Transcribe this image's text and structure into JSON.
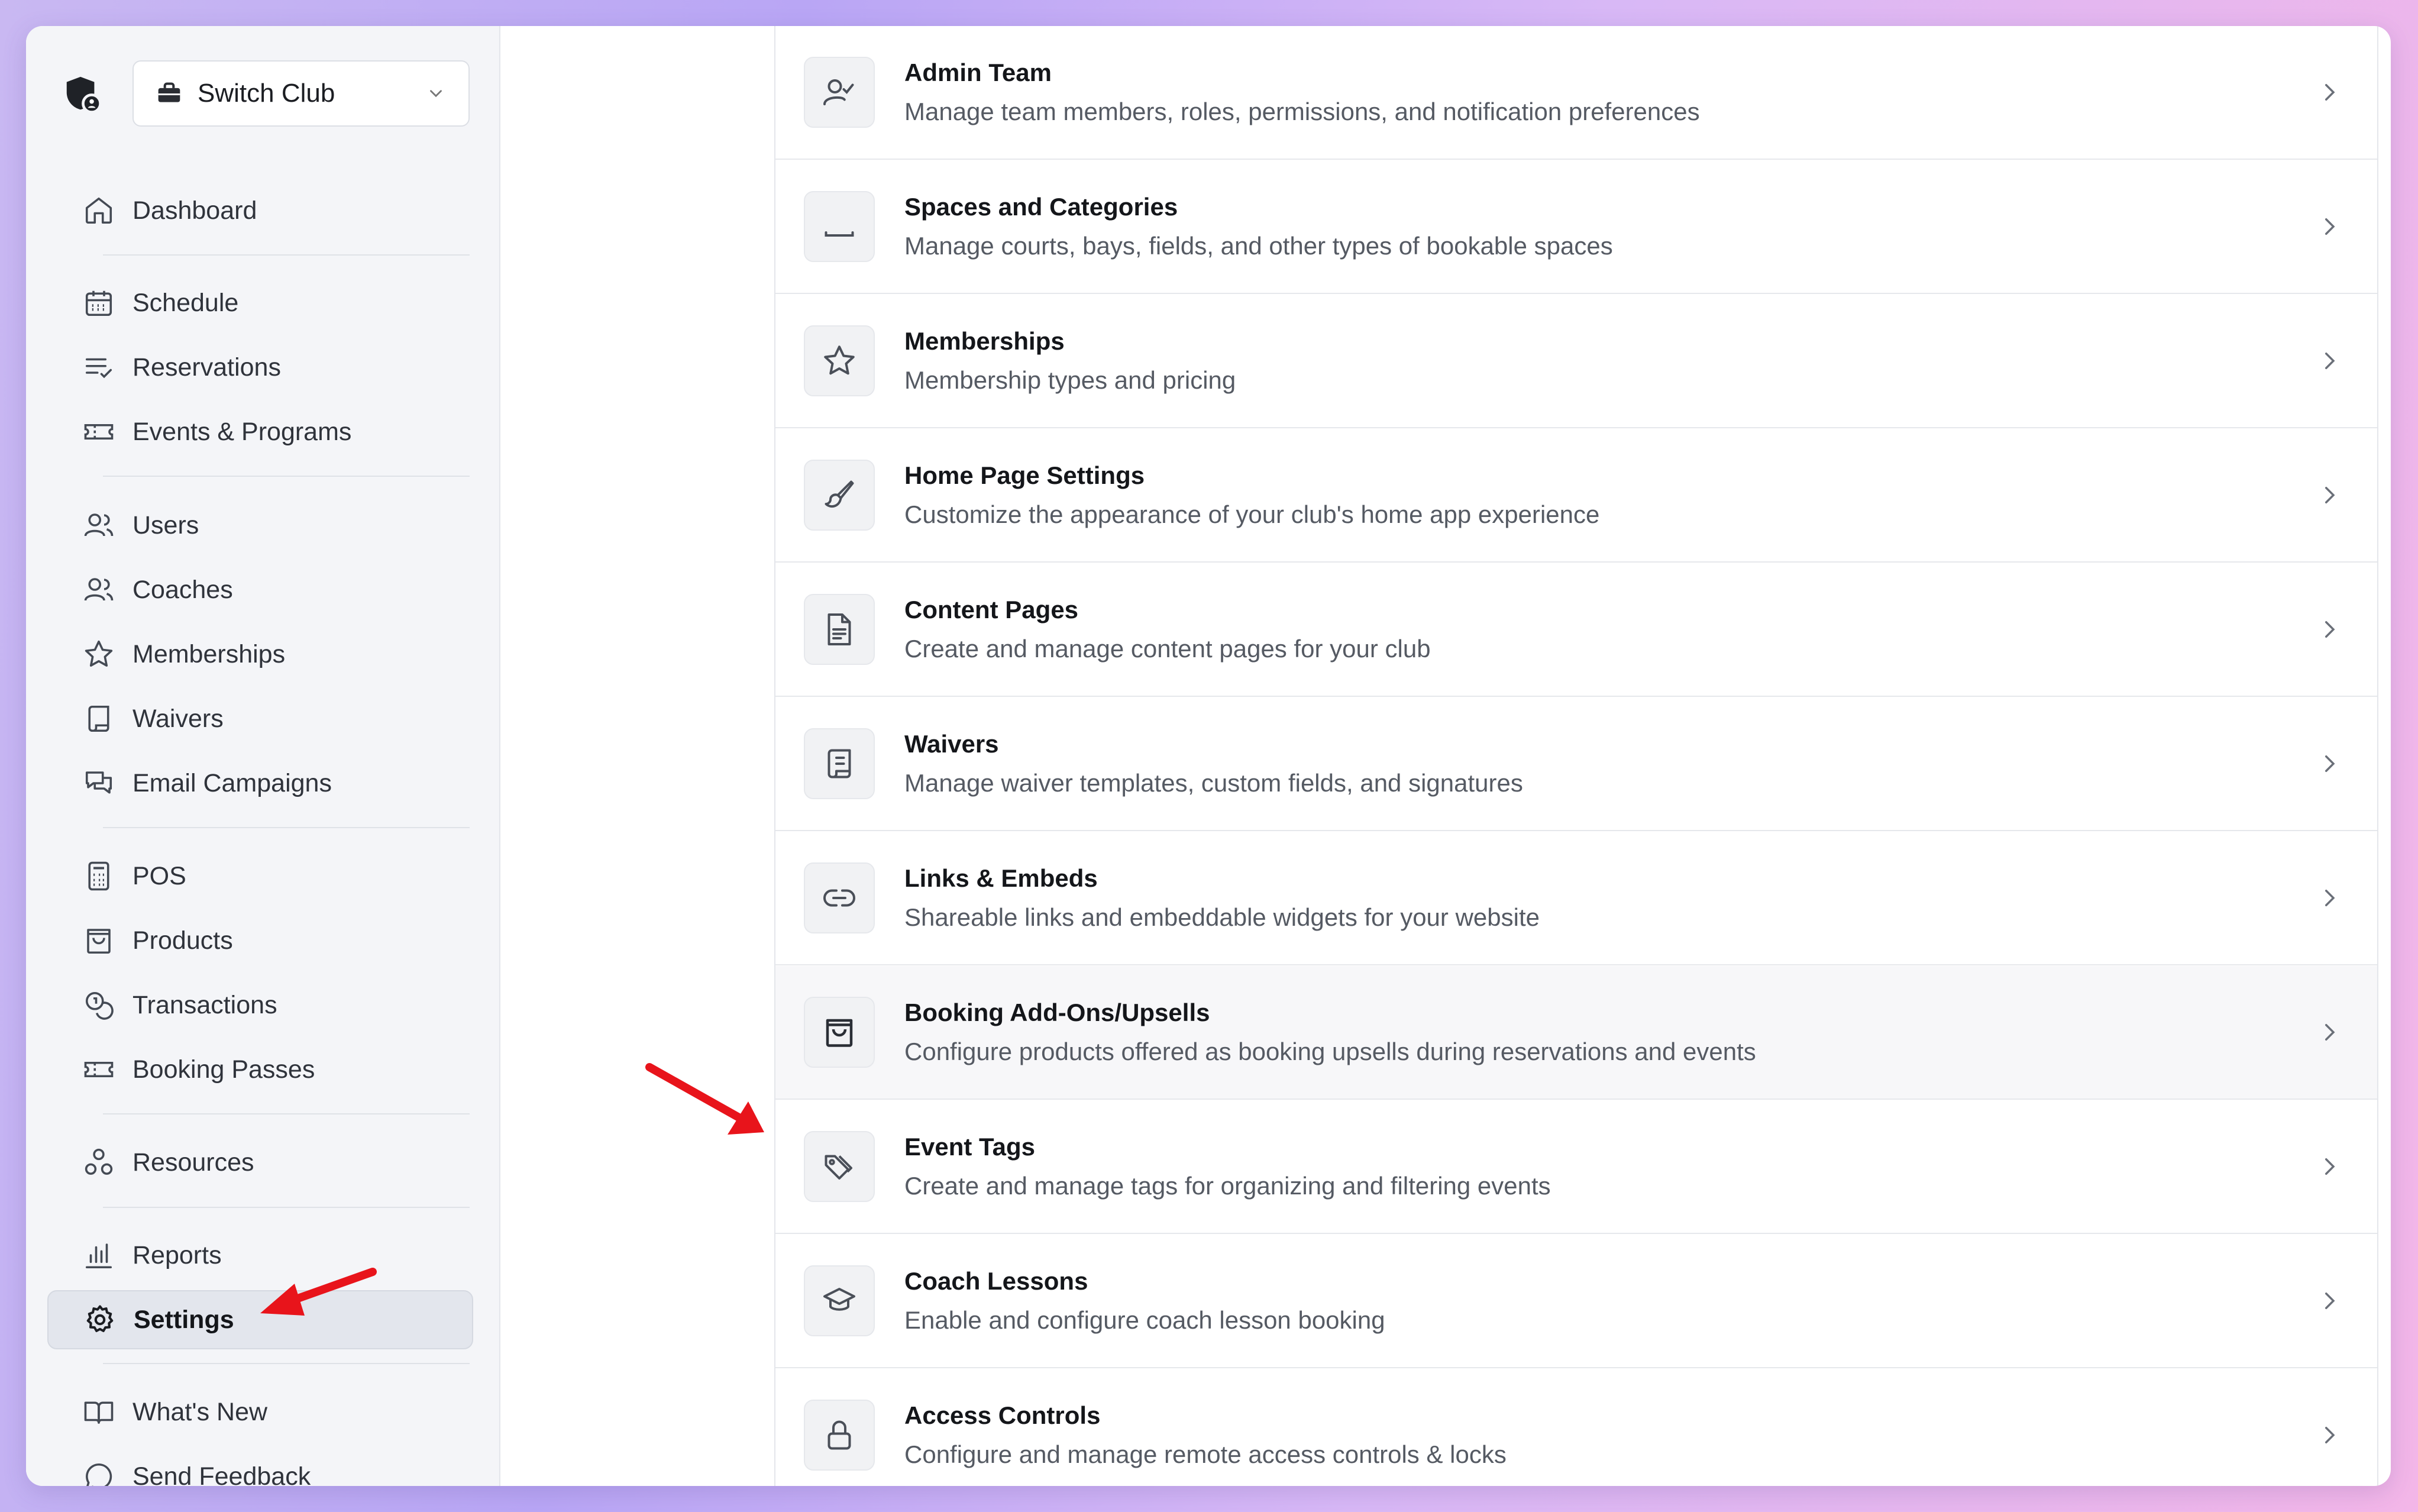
{
  "club": {
    "name": "Switch Club"
  },
  "nav": {
    "dashboard": "Dashboard",
    "schedule": "Schedule",
    "reservations": "Reservations",
    "events": "Events & Programs",
    "users": "Users",
    "coaches": "Coaches",
    "memberships": "Memberships",
    "waivers": "Waivers",
    "email": "Email Campaigns",
    "pos": "POS",
    "products": "Products",
    "transactions": "Transactions",
    "passes": "Booking Passes",
    "resources": "Resources",
    "reports": "Reports",
    "settings": "Settings",
    "whats_new": "What's New",
    "feedback": "Send Feedback"
  },
  "settings_rows": [
    {
      "title": "Admin Team",
      "desc": "Manage team members, roles, permissions, and notification preferences"
    },
    {
      "title": "Spaces and Categories",
      "desc": "Manage courts, bays, fields, and other types of bookable spaces"
    },
    {
      "title": "Memberships",
      "desc": "Membership types and pricing"
    },
    {
      "title": "Home Page Settings",
      "desc": "Customize the appearance of your club's home app experience"
    },
    {
      "title": "Content Pages",
      "desc": "Create and manage content pages for your club"
    },
    {
      "title": "Waivers",
      "desc": "Manage waiver templates, custom fields, and signatures"
    },
    {
      "title": "Links & Embeds",
      "desc": "Shareable links and embeddable widgets for your website"
    },
    {
      "title": "Booking Add-Ons/Upsells",
      "desc": "Configure products offered as booking upsells during reservations and events"
    },
    {
      "title": "Event Tags",
      "desc": "Create and manage tags for organizing and filtering events"
    },
    {
      "title": "Coach Lessons",
      "desc": "Enable and configure coach lesson booking"
    },
    {
      "title": "Access Controls",
      "desc": "Configure and manage remote access controls & locks"
    }
  ],
  "colors": {
    "annotation": "#e8141b",
    "active_nav": "#e3e6ed"
  }
}
